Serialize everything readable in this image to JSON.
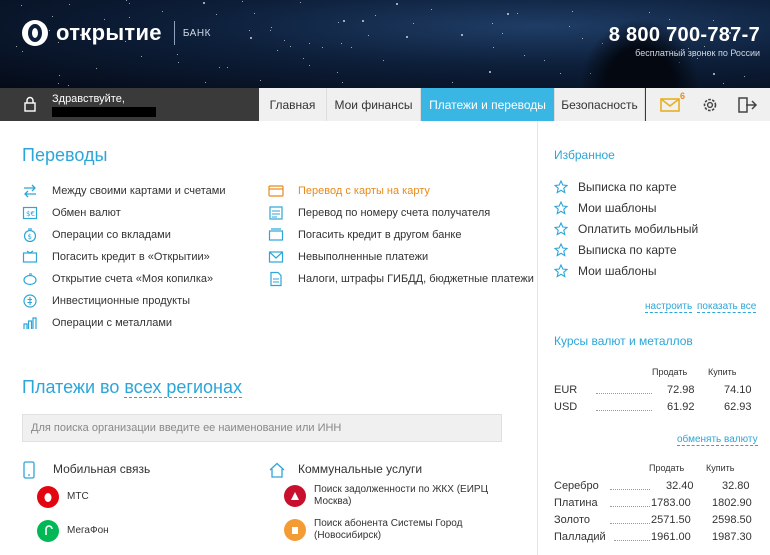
{
  "header": {
    "logo_text": "открытие",
    "logo_sub": "БАНК",
    "phone": "8 800 700-787-7",
    "phone_note": "бесплатный звонок по России"
  },
  "nav": {
    "greeting": "Здравствуйте,",
    "tabs": [
      {
        "label": "Главная",
        "active": false
      },
      {
        "label": "Мои финансы",
        "active": false
      },
      {
        "label": "Платежи и переводы",
        "active": true
      },
      {
        "label": "Безопасность",
        "active": false
      }
    ],
    "mail_badge": "6",
    "icons": [
      "mail-icon",
      "gear-icon",
      "logout-icon"
    ]
  },
  "transfers": {
    "title": "Переводы",
    "left": [
      {
        "label": "Между своими картами и счетами",
        "icon": "arrows-icon"
      },
      {
        "label": "Обмен валют",
        "icon": "currency-exchange-icon"
      },
      {
        "label": "Операции со вкладами",
        "icon": "deposit-icon"
      },
      {
        "label": "Погасить кредит в «Открытии»",
        "icon": "credit-icon"
      },
      {
        "label": "Открытие счета «Моя копилка»",
        "icon": "piggy-bank-icon"
      },
      {
        "label": "Инвестиционные продукты",
        "icon": "investment-icon"
      },
      {
        "label": "Операции с металлами",
        "icon": "metals-icon"
      }
    ],
    "right": [
      {
        "label": "Перевод с карты на карту",
        "icon": "card-to-card-icon",
        "highlight": true
      },
      {
        "label": "Перевод по номеру счета получателя",
        "icon": "account-transfer-icon",
        "highlight": false
      },
      {
        "label": "Погасить кредит в другом банке",
        "icon": "other-bank-icon",
        "highlight": false
      },
      {
        "label": "Невыполненные платежи",
        "icon": "envelope-icon",
        "highlight": false
      },
      {
        "label": "Налоги, штрафы ГИБДД, бюджетные платежи",
        "icon": "taxes-icon",
        "highlight": false
      }
    ]
  },
  "payments": {
    "title_prefix": "Платежи во ",
    "title_link": "всех регионах",
    "search_placeholder": "Для поиска организации введите ее наименование или ИНН",
    "mobile": {
      "title": "Мобильная связь",
      "providers": [
        {
          "name": "МТС",
          "color": "#e30611"
        },
        {
          "name": "МегаФон",
          "color": "#00b956"
        }
      ]
    },
    "utilities": {
      "title": "Коммунальные услуги",
      "providers": [
        {
          "line1": "Поиск задолженности по ЖКХ (ЕИРЦ",
          "line2": "Москва)",
          "color": "#c8102e"
        },
        {
          "line1": "Поиск абонента Системы Город",
          "line2": "(Новосибирск)",
          "color": "#f39c34"
        }
      ]
    }
  },
  "favorites": {
    "title": "Избранное",
    "items": [
      "Выписка по карте",
      "Мои шаблоны",
      "Оплатить мобильный",
      "Выписка по карте",
      "Мои шаблоны"
    ],
    "configure": "настроить",
    "show_all": "показать все"
  },
  "rates": {
    "title": "Курсы валют и металлов",
    "sell_label": "Продать",
    "buy_label": "Купить",
    "currencies": [
      {
        "name": "EUR",
        "sell": "72.98",
        "buy": "74.10"
      },
      {
        "name": "USD",
        "sell": "61.92",
        "buy": "62.93"
      }
    ],
    "change_currency": "обменять валюту",
    "metals": [
      {
        "name": "Серебро",
        "sell": "32.40",
        "buy": "32.80"
      },
      {
        "name": "Платина",
        "sell": "1783.00",
        "buy": "1802.90"
      },
      {
        "name": "Золото",
        "sell": "2571.50",
        "buy": "2598.50"
      },
      {
        "name": "Палладий",
        "sell": "1961.00",
        "buy": "1987.30"
      }
    ]
  },
  "colors": {
    "accent": "#2ca6d8",
    "orange": "#e88a1a",
    "nav_bg": "#3a3a3a",
    "active_tab": "#3ab6e4"
  }
}
